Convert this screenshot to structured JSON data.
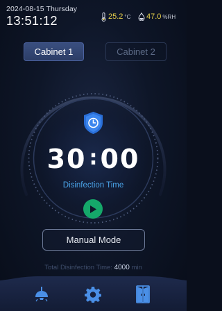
{
  "status": {
    "date": "2024-08-15 Thursday",
    "time": "13:51:12",
    "temperature": "25.2",
    "temperature_unit": "°C",
    "humidity": "47.0",
    "humidity_unit": "%RH"
  },
  "tabs": [
    {
      "label": "Cabinet 1",
      "active": true
    },
    {
      "label": "Cabinet 2",
      "active": false
    }
  ],
  "timer": {
    "minutes": "30",
    "colon": ":",
    "seconds": "00",
    "caption": "Disinfection Time"
  },
  "mode_button": {
    "label": "Manual Mode"
  },
  "total": {
    "label": "Total Disinfection Time:",
    "value": "4000",
    "unit": "min"
  },
  "nav": {
    "items": [
      "lamp-icon",
      "gear-icon",
      "cabinet-door-icon"
    ]
  },
  "colors": {
    "accent_blue": "#4aa3e8",
    "value_yellow": "#e8d24a",
    "play_green": "#15a86a"
  }
}
